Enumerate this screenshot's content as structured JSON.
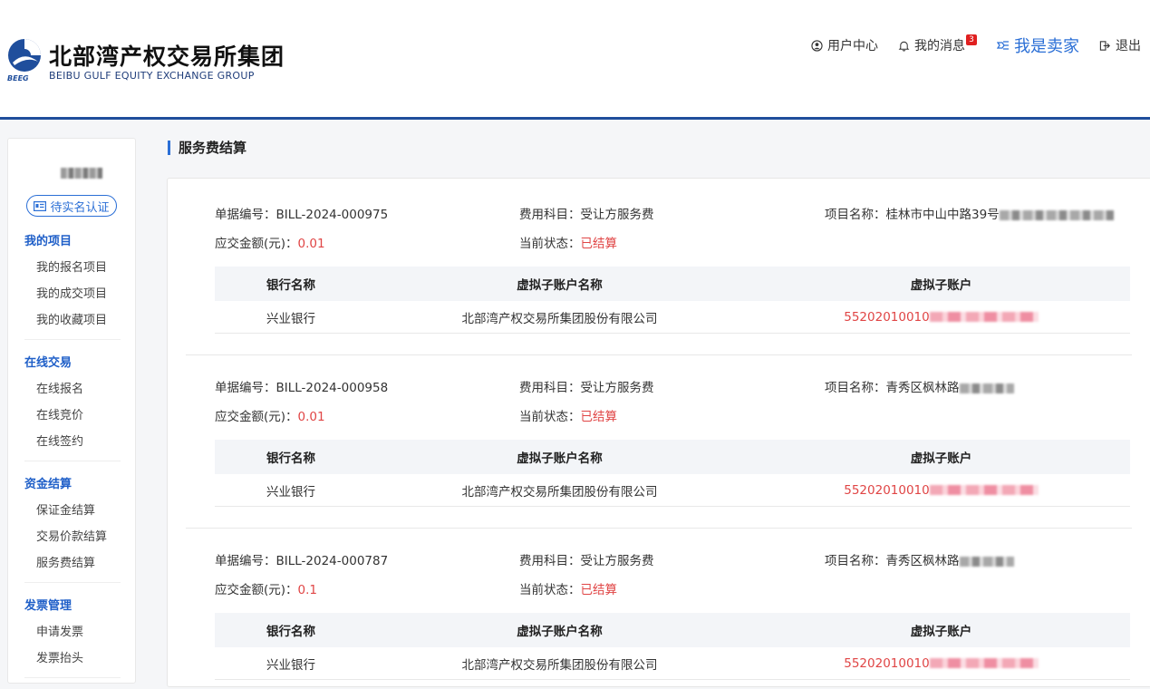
{
  "header": {
    "brand_cn": "北部湾产权交易所集团",
    "brand_en": "BEIBU GULF EQUITY EXCHANGE GROUP",
    "brand_abbr": "BEEG",
    "nav": {
      "user_center": "用户中心",
      "messages": "我的消息",
      "message_count": "3",
      "seller": "我是卖家",
      "logout": "退出"
    }
  },
  "sidebar": {
    "verify_label": "待实名认证",
    "groups": [
      {
        "title": "我的项目",
        "items": [
          "我的报名项目",
          "我的成交项目",
          "我的收藏项目"
        ]
      },
      {
        "title": "在线交易",
        "items": [
          "在线报名",
          "在线竞价",
          "在线签约"
        ]
      },
      {
        "title": "资金结算",
        "items": [
          "保证金结算",
          "交易价款结算",
          "服务费结算"
        ]
      },
      {
        "title": "发票管理",
        "items": [
          "申请发票",
          "发票抬头"
        ]
      }
    ]
  },
  "main": {
    "title": "服务费结算",
    "labels": {
      "bill_no": "单据编号：",
      "fee_item": "费用科目：",
      "project_name": "项目名称：",
      "amount": "应交金额(元)：",
      "status": "当前状态："
    },
    "table_headers": [
      "银行名称",
      "虚拟子账户名称",
      "虚拟子账户"
    ],
    "bills": [
      {
        "bill_no": "BILL-2024-000975",
        "fee_item": "受让方服务费",
        "project_name": "桂林市中山中路39号",
        "amount": "0.01",
        "status": "已结算",
        "bank": "兴业银行",
        "account_name": "北部湾产权交易所集团股份有限公司",
        "account": "55202010010"
      },
      {
        "bill_no": "BILL-2024-000958",
        "fee_item": "受让方服务费",
        "project_name": "青秀区枫林路",
        "amount": "0.01",
        "status": "已结算",
        "bank": "兴业银行",
        "account_name": "北部湾产权交易所集团股份有限公司",
        "account": "55202010010"
      },
      {
        "bill_no": "BILL-2024-000787",
        "fee_item": "受让方服务费",
        "project_name": "青秀区枫林路",
        "amount": "0.1",
        "status": "已结算",
        "bank": "兴业银行",
        "account_name": "北部湾产权交易所集团股份有限公司",
        "account": "55202010010"
      }
    ]
  },
  "colors": {
    "accent": "#2b6fd6",
    "header_border": "#1f4e9c",
    "status_red": "#e04545",
    "badge": "#e02020"
  }
}
